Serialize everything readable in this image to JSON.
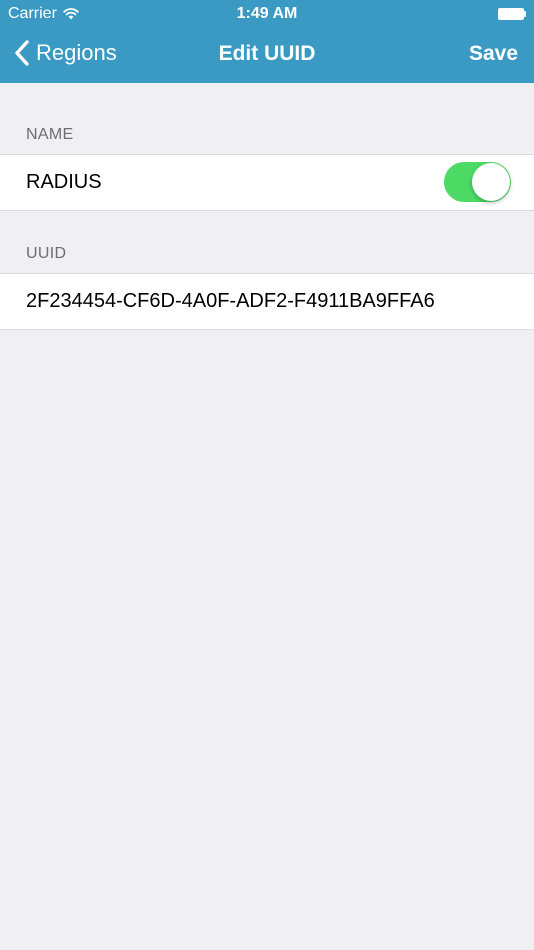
{
  "status_bar": {
    "carrier": "Carrier",
    "time": "1:49 AM",
    "wifi_icon": "wifi-icon",
    "battery_icon": "battery-icon"
  },
  "nav": {
    "back_label": "Regions",
    "back_icon": "chevron-left-icon",
    "title": "Edit UUID",
    "save_label": "Save",
    "bar_color": "#3a9ac3"
  },
  "name_section": {
    "header": "NAME",
    "value": "RADIUS",
    "toggle_on": true,
    "toggle_color": "#4cd964"
  },
  "uuid_section": {
    "header": "UUID",
    "value": "2F234454-CF6D-4A0F-ADF2-F4911BA9FFA6"
  }
}
